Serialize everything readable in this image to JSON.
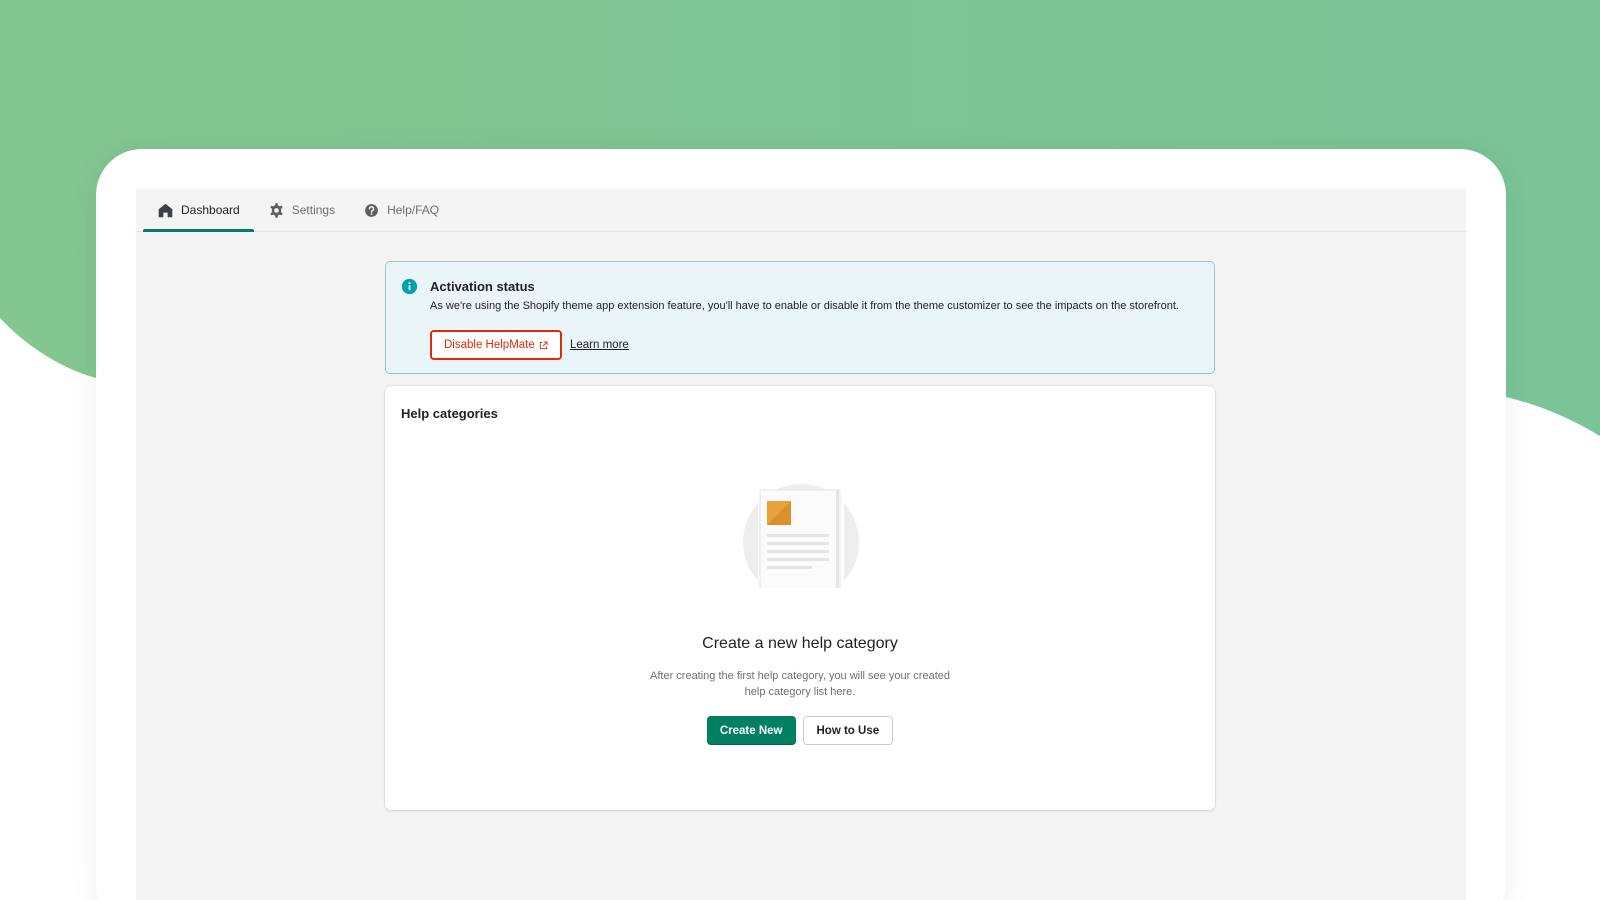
{
  "colors": {
    "background_green": "#84c690",
    "accent": "#008060",
    "critical": "#d82c0d",
    "banner_bg": "#eaf5f9",
    "info_icon": "#00a0ac"
  },
  "tabs": [
    {
      "label": "Dashboard",
      "icon": "home-icon",
      "active": true
    },
    {
      "label": "Settings",
      "icon": "gear-icon",
      "active": false
    },
    {
      "label": "Help/FAQ",
      "icon": "question-circle-icon",
      "active": false
    }
  ],
  "banner": {
    "icon": "info-icon",
    "title": "Activation status",
    "text": "As we're using the Shopify theme app extension feature, you'll have to enable or disable it from the theme customizer to see the impacts on the storefront.",
    "disable_button": "Disable HelpMate",
    "disable_button_icon": "external-link-icon",
    "learn_more": "Learn more"
  },
  "card": {
    "title": "Help categories",
    "empty_heading": "Create a new help category",
    "empty_text": "After creating the first help category, you will see your created help category list here.",
    "primary_button": "Create New",
    "secondary_button": "How to Use"
  }
}
